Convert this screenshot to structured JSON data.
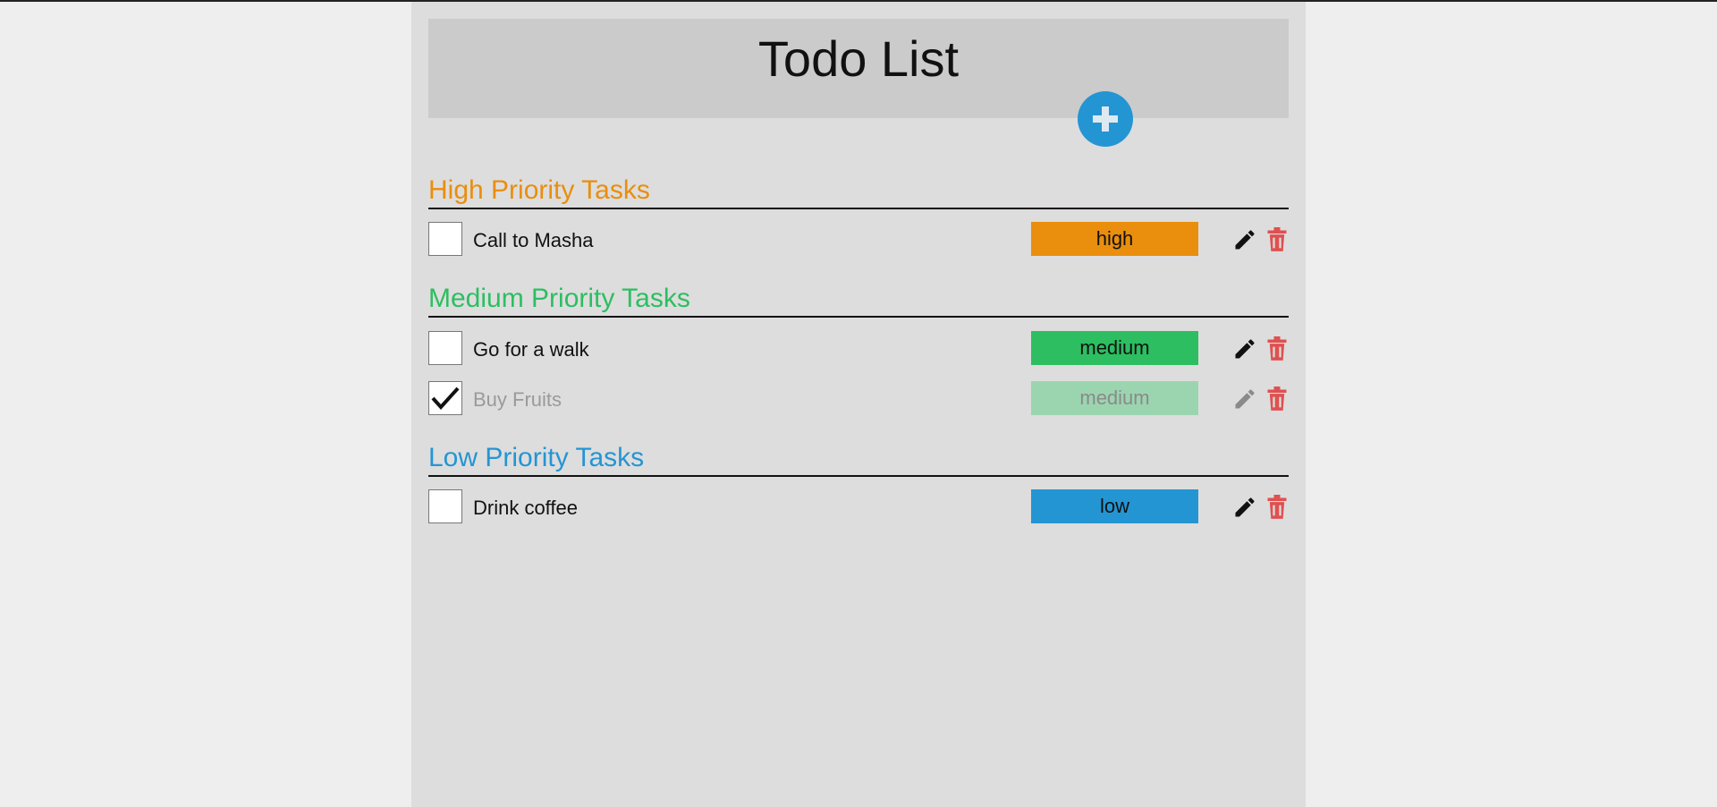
{
  "header": {
    "title": "Todo List",
    "add_icon": "plus-icon"
  },
  "colors": {
    "high": "#e98e0d",
    "medium": "#2dbe61",
    "medium_done": "#9bd5b0",
    "low": "#2495d3",
    "delete": "#e05050",
    "add_button": "#2495d3"
  },
  "sections": [
    {
      "title": "High Priority Tasks",
      "tasks": [
        {
          "text": "Call to Masha",
          "priority": "high",
          "done": false
        }
      ]
    },
    {
      "title": "Medium Priority Tasks",
      "tasks": [
        {
          "text": "Go for a walk",
          "priority": "medium",
          "done": false
        },
        {
          "text": "Buy Fruits",
          "priority": "medium",
          "done": true
        }
      ]
    },
    {
      "title": "Low Priority Tasks",
      "tasks": [
        {
          "text": "Drink coffee",
          "priority": "low",
          "done": false
        }
      ]
    }
  ],
  "icons": {
    "edit": "pencil-icon",
    "delete": "trash-icon",
    "check": "checkmark-icon"
  }
}
